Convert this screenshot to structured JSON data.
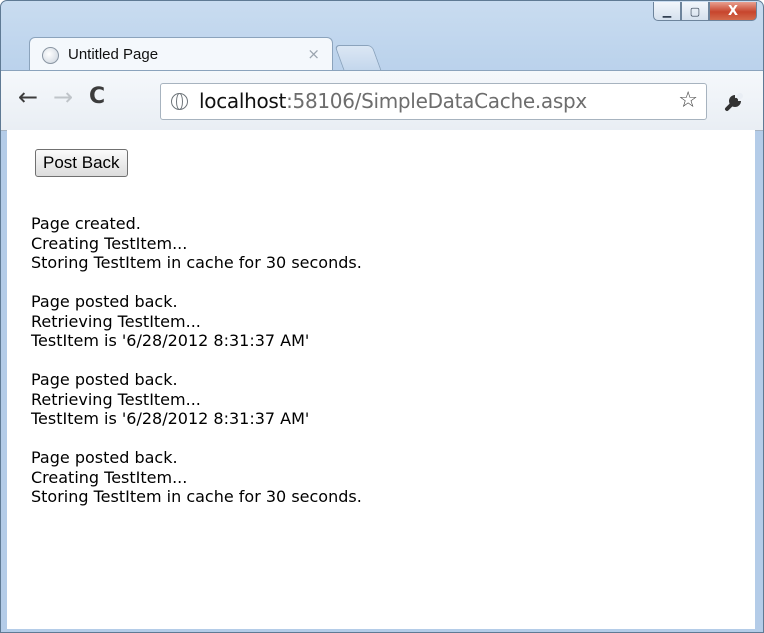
{
  "window": {
    "controls": {
      "minimize": "▁",
      "maximize": "▢",
      "close": "X"
    }
  },
  "tab": {
    "title": "Untitled Page",
    "close_symbol": "×"
  },
  "toolbar": {
    "back_symbol": "←",
    "forward_symbol": "→",
    "reload_symbol": "C",
    "address_host": "localhost",
    "address_path": ":58106/SimpleDataCache.aspx",
    "bookmark_symbol": "☆"
  },
  "page": {
    "button_label": "Post Back",
    "log": [
      [
        "Page created.",
        "Creating TestItem...",
        "Storing TestItem in cache for 30 seconds."
      ],
      [
        "Page posted back.",
        "Retrieving TestItem...",
        "TestItem is '6/28/2012 8:31:37 AM'"
      ],
      [
        "Page posted back.",
        "Retrieving TestItem...",
        "TestItem is '6/28/2012 8:31:37 AM'"
      ],
      [
        "Page posted back.",
        "Creating TestItem...",
        "Storing TestItem in cache for 30 seconds."
      ]
    ]
  }
}
